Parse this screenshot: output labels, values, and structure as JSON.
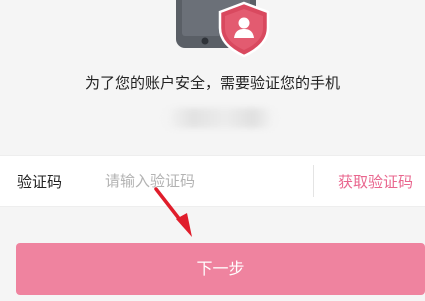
{
  "notice": {
    "text": "为了您的账户安全，需要验证您的手机"
  },
  "verify": {
    "label": "验证码",
    "placeholder": "请输入验证码",
    "get_code_label": "获取验证码"
  },
  "next_button": {
    "label": "下一步"
  },
  "colors": {
    "accent": "#e9668e",
    "button_bg": "#ef839f",
    "shield": "#d9495f",
    "phone": "#5a5f66"
  },
  "icons": [
    "phone-icon",
    "shield-user-icon",
    "arrow-pointer-icon"
  ]
}
